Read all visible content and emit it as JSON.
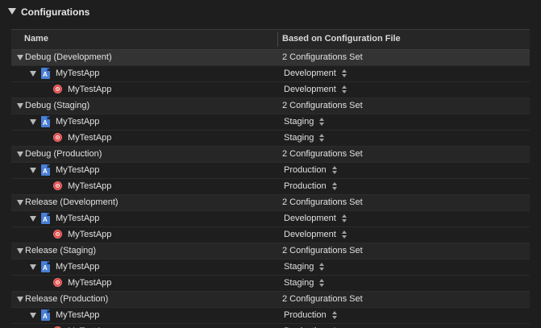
{
  "section": {
    "title": "Configurations"
  },
  "table": {
    "headers": {
      "name": "Name",
      "based": "Based on Configuration File"
    },
    "groups": [
      {
        "name": "Debug (Development)",
        "summary": "2 Configurations Set",
        "project": {
          "name": "MyTestApp",
          "config": "Development"
        },
        "target": {
          "name": "MyTestApp",
          "config": "Development"
        }
      },
      {
        "name": "Debug (Staging)",
        "summary": "2 Configurations Set",
        "project": {
          "name": "MyTestApp",
          "config": "Staging"
        },
        "target": {
          "name": "MyTestApp",
          "config": "Staging"
        }
      },
      {
        "name": "Debug (Production)",
        "summary": "2 Configurations Set",
        "project": {
          "name": "MyTestApp",
          "config": "Production"
        },
        "target": {
          "name": "MyTestApp",
          "config": "Production"
        }
      },
      {
        "name": "Release (Development)",
        "summary": "2 Configurations Set",
        "project": {
          "name": "MyTestApp",
          "config": "Development"
        },
        "target": {
          "name": "MyTestApp",
          "config": "Development"
        }
      },
      {
        "name": "Release (Staging)",
        "summary": "2 Configurations Set",
        "project": {
          "name": "MyTestApp",
          "config": "Staging"
        },
        "target": {
          "name": "MyTestApp",
          "config": "Staging"
        }
      },
      {
        "name": "Release (Production)",
        "summary": "2 Configurations Set",
        "project": {
          "name": "MyTestApp",
          "config": "Production"
        },
        "target": {
          "name": "MyTestApp",
          "config": "Production"
        }
      }
    ]
  },
  "icons": {
    "section_toggle": "disclosure-triangle-icon",
    "project": "xcode-project-icon",
    "target": "app-target-icon",
    "stepper": "popup-stepper-icon"
  },
  "colors": {
    "background": "#1e1e1e",
    "selected_row": "#333333",
    "target_icon": "#e24a4a",
    "project_icon": "#4a7fd6"
  }
}
